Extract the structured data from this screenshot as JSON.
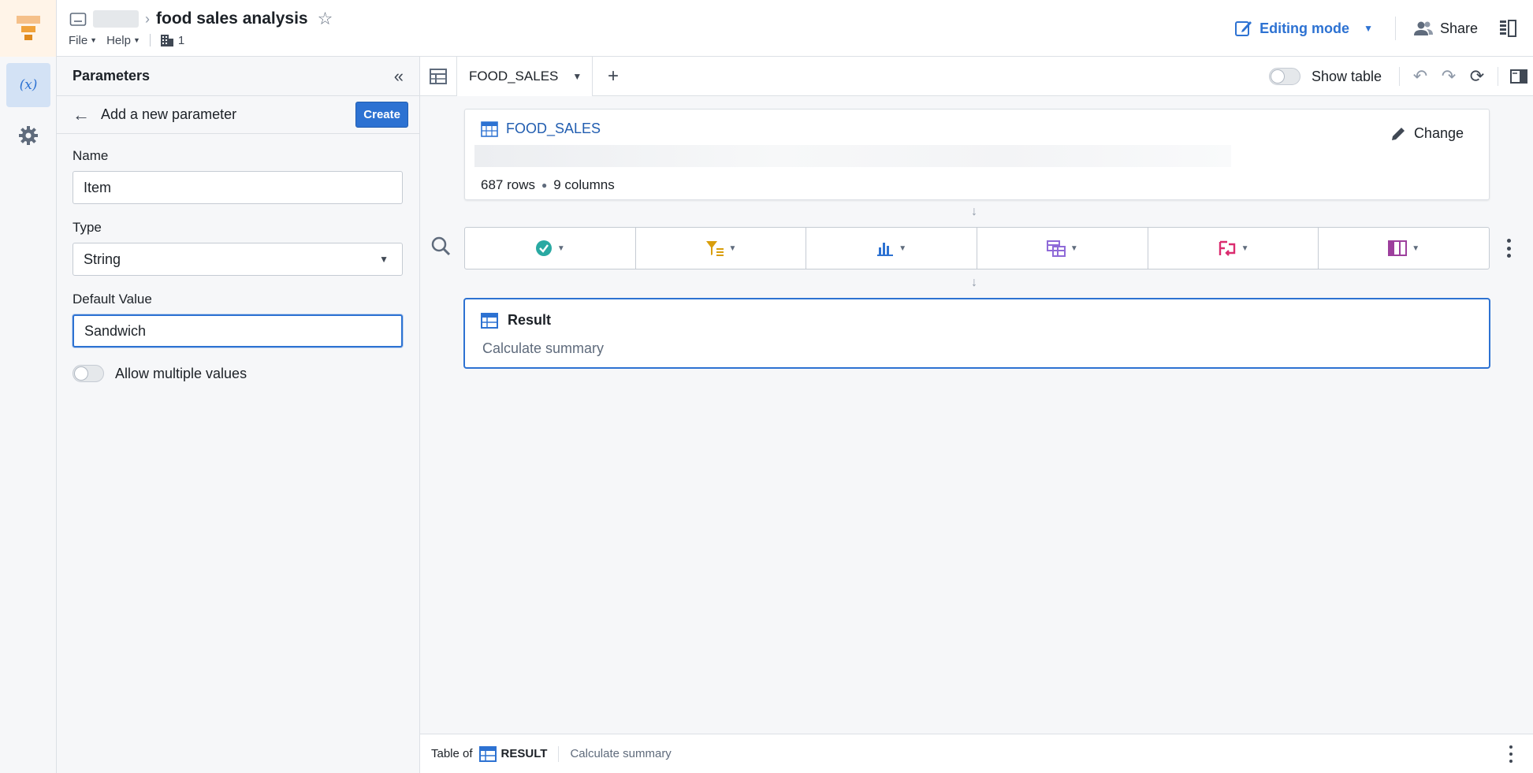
{
  "header": {
    "title": "food sales analysis",
    "menus": [
      {
        "label": "File"
      },
      {
        "label": "Help"
      }
    ],
    "org_count": "1",
    "editing_mode_label": "Editing mode",
    "share_label": "Share"
  },
  "parameters_panel": {
    "title": "Parameters",
    "subheader": "Add a new parameter",
    "create_label": "Create",
    "name_label": "Name",
    "name_value": "Item",
    "type_label": "Type",
    "type_value": "String",
    "default_label": "Default Value",
    "default_value": "Sandwich",
    "allow_multiple_label": "Allow multiple values",
    "allow_multiple_on": false
  },
  "tabs": {
    "active_tab": "FOOD_SALES",
    "show_table_label": "Show table",
    "show_table_on": false
  },
  "source": {
    "name": "FOOD_SALES",
    "rows": "687 rows",
    "columns": "9 columns",
    "change_label": "Change"
  },
  "operations": [
    {
      "icon": "check-circle-icon",
      "color": "#29a9a2"
    },
    {
      "icon": "filter-icon",
      "color": "#d99e0b"
    },
    {
      "icon": "bar-chart-icon",
      "color": "#2d72d2"
    },
    {
      "icon": "pivot-table-icon",
      "color": "#8f6ad8"
    },
    {
      "icon": "join-icon",
      "color": "#db2c6f"
    },
    {
      "icon": "columns-icon",
      "color": "#9d3f9d"
    }
  ],
  "result": {
    "title": "Result",
    "subtitle": "Calculate summary"
  },
  "bottom": {
    "table_of_label": "Table of",
    "result_name": "RESULT",
    "subtitle": "Calculate summary"
  },
  "colors": {
    "accent": "#2d72d2",
    "logo": "#f0a23b"
  }
}
